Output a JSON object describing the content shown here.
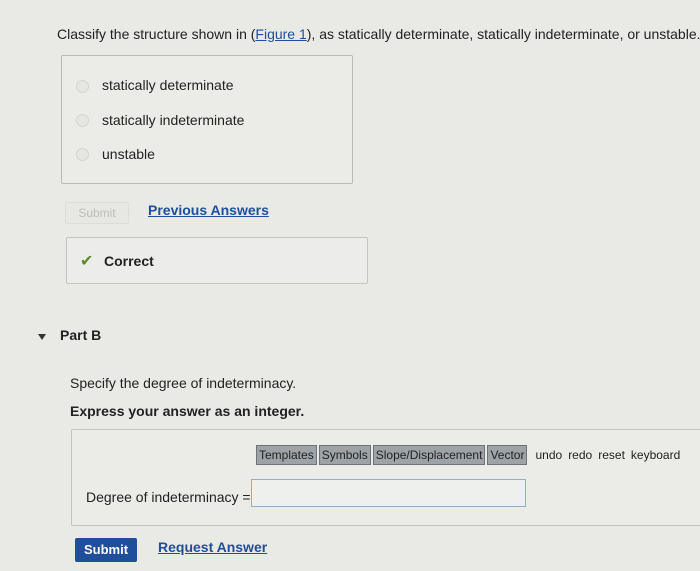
{
  "partA": {
    "question_prefix": "Classify the structure shown in (",
    "figure_link": "Figure 1",
    "question_suffix": "), as statically determinate, statically indeterminate, or unstable.",
    "choices": [
      "statically determinate",
      "statically indeterminate",
      "unstable"
    ],
    "submit_label": "Submit",
    "previous_answers": "Previous Answers",
    "feedback": "Correct"
  },
  "partB": {
    "title": "Part B",
    "prompt": "Specify the degree of indeterminacy.",
    "instruction": "Express your answer as an integer.",
    "toolbar": {
      "buttons": [
        "Templates",
        "Symbols",
        "Slope/Displacement",
        "Vector"
      ],
      "links": [
        "undo",
        "redo",
        "reset",
        "keyboard"
      ]
    },
    "input_label": "Degree of indeterminacy =",
    "input_value": "",
    "submit_label": "Submit",
    "request_answer": "Request Answer"
  },
  "colors": {
    "link": "#1f4f9b",
    "check": "#5c8d2c",
    "background": "#e9e9e6"
  },
  "icons": {
    "feedback": "checkmark-icon",
    "collapse": "triangle-down-icon"
  }
}
